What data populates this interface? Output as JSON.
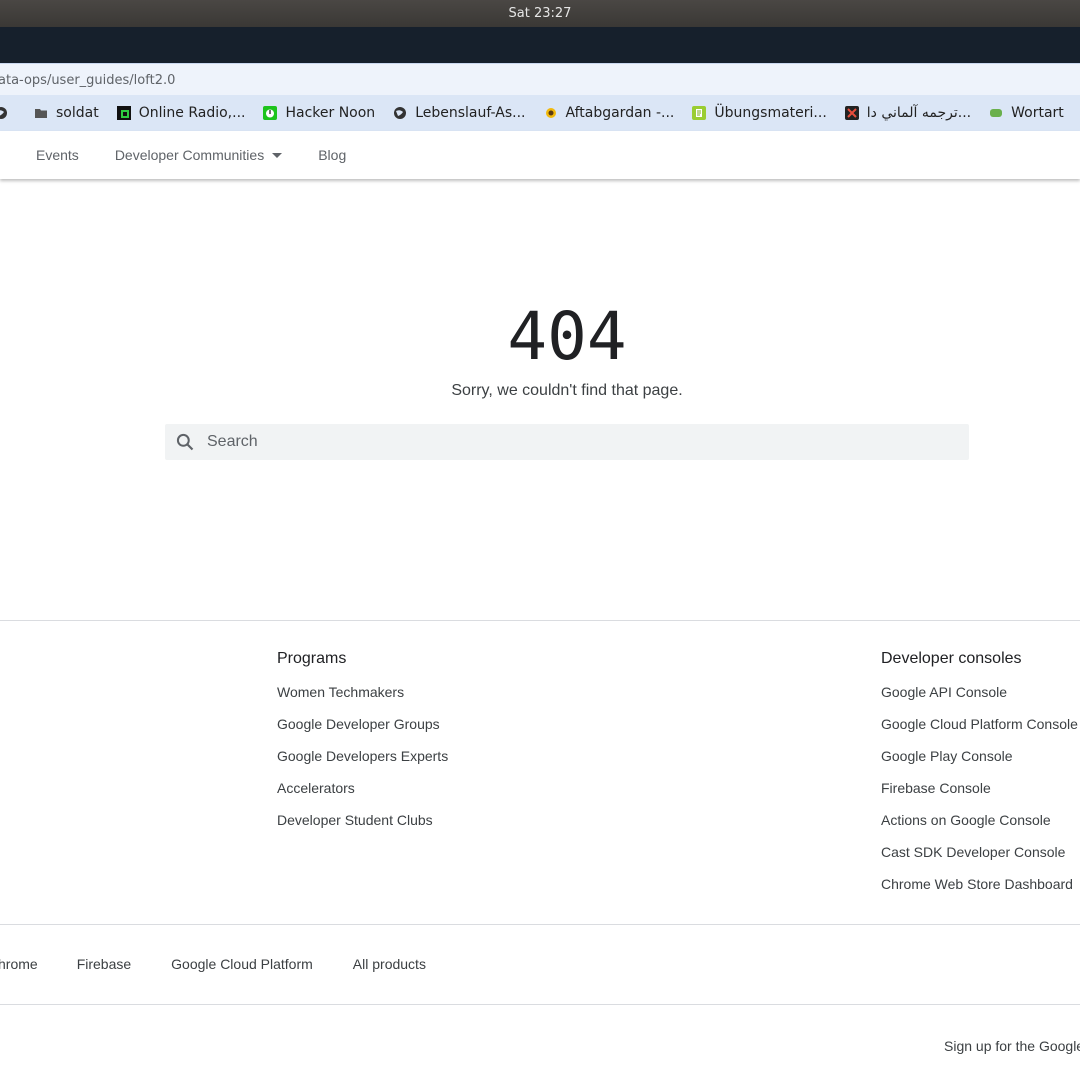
{
  "system": {
    "clock": "Sat 23:27"
  },
  "browser": {
    "url": "ata-ops/user_guides/loft2.0",
    "bookmarks": [
      {
        "label": "",
        "icon": "globe-icon"
      },
      {
        "label": "soldat",
        "icon": "folder-icon"
      },
      {
        "label": "Online Radio,...",
        "icon": "radio-favicon"
      },
      {
        "label": "Hacker Noon",
        "icon": "hackernoon-favicon"
      },
      {
        "label": "Lebenslauf-As...",
        "icon": "globe-icon"
      },
      {
        "label": "Aftabgardan -...",
        "icon": "sunflower-favicon"
      },
      {
        "label": "Übungsmateri...",
        "icon": "exercise-favicon"
      },
      {
        "label": "ترجمه آلماني دا...",
        "icon": "translate-favicon"
      },
      {
        "label": "Wortart",
        "icon": "wortart-favicon"
      }
    ]
  },
  "nav": {
    "events": "Events",
    "communities": "Developer Communities",
    "blog": "Blog"
  },
  "error": {
    "code": "404",
    "message": "Sorry, we couldn't find that page.",
    "search_placeholder": "Search"
  },
  "footer": {
    "programs": {
      "heading": "Programs",
      "links": [
        "Women Techmakers",
        "Google Developer Groups",
        "Google Developers Experts",
        "Accelerators",
        "Developer Student Clubs"
      ]
    },
    "consoles": {
      "heading": "Developer consoles",
      "links": [
        "Google API Console",
        "Google Cloud Platform Console",
        "Google Play Console",
        "Firebase Console",
        "Actions on Google Console",
        "Cast SDK Developer Console",
        "Chrome Web Store Dashboard"
      ]
    },
    "products": [
      "hrome",
      "Firebase",
      "Google Cloud Platform",
      "All products"
    ],
    "signup": "Sign up for the Google"
  }
}
